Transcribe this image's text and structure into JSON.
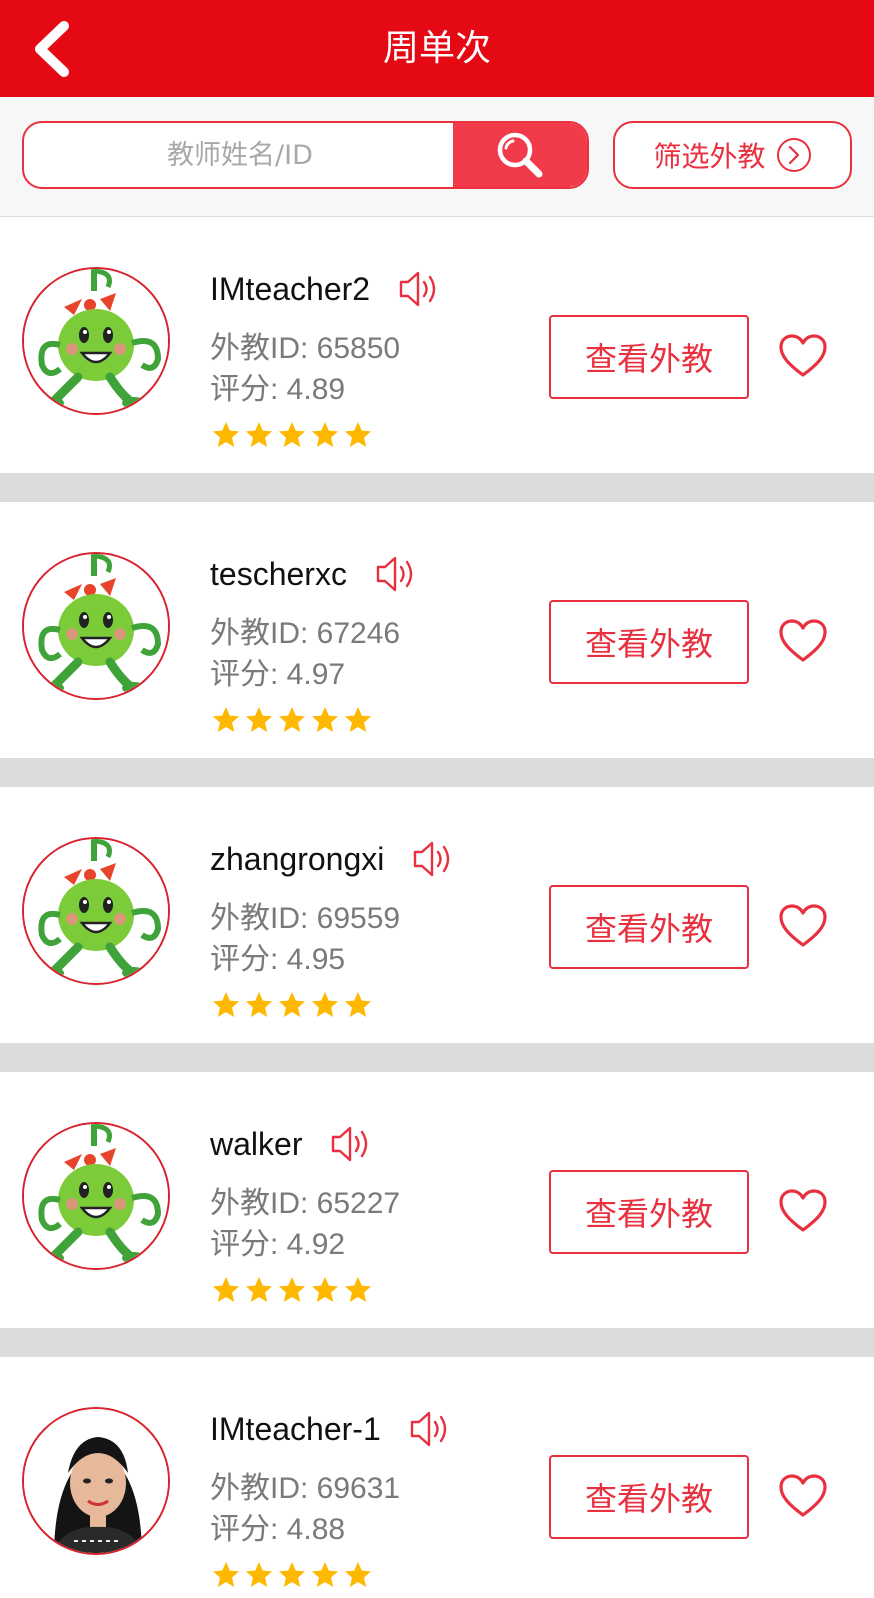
{
  "header": {
    "title": "周单次",
    "back_icon": "chevron-left-icon"
  },
  "search": {
    "placeholder": "教师姓名/ID",
    "value": "",
    "search_icon": "search-icon"
  },
  "filter": {
    "label": "筛选外教",
    "icon": "chevron-right-circle-icon"
  },
  "colors": {
    "brand_red": "#e50914",
    "accent_red": "#e8303f",
    "star_gold": "#ffb800",
    "avatar_green": "#7ccc3a"
  },
  "teachers": [
    {
      "name": "IMteacher2",
      "id_text": "外教ID: 65850",
      "score_text": "评分: 4.89",
      "rating": 5,
      "avatar": "mascot",
      "action": "查看外教"
    },
    {
      "name": "tescherxc",
      "id_text": "外教ID: 67246",
      "score_text": "评分: 4.97",
      "rating": 5,
      "avatar": "mascot",
      "action": "查看外教"
    },
    {
      "name": "zhangrongxi",
      "id_text": "外教ID: 69559",
      "score_text": "评分: 4.95",
      "rating": 5,
      "avatar": "mascot",
      "action": "查看外教"
    },
    {
      "name": "walker",
      "id_text": "外教ID: 65227",
      "score_text": "评分: 4.92",
      "rating": 5,
      "avatar": "mascot",
      "action": "查看外教"
    },
    {
      "name": "IMteacher-1",
      "id_text": "外教ID: 69631",
      "score_text": "评分: 4.88",
      "rating": 5,
      "avatar": "photo",
      "action": "查看外教"
    }
  ]
}
